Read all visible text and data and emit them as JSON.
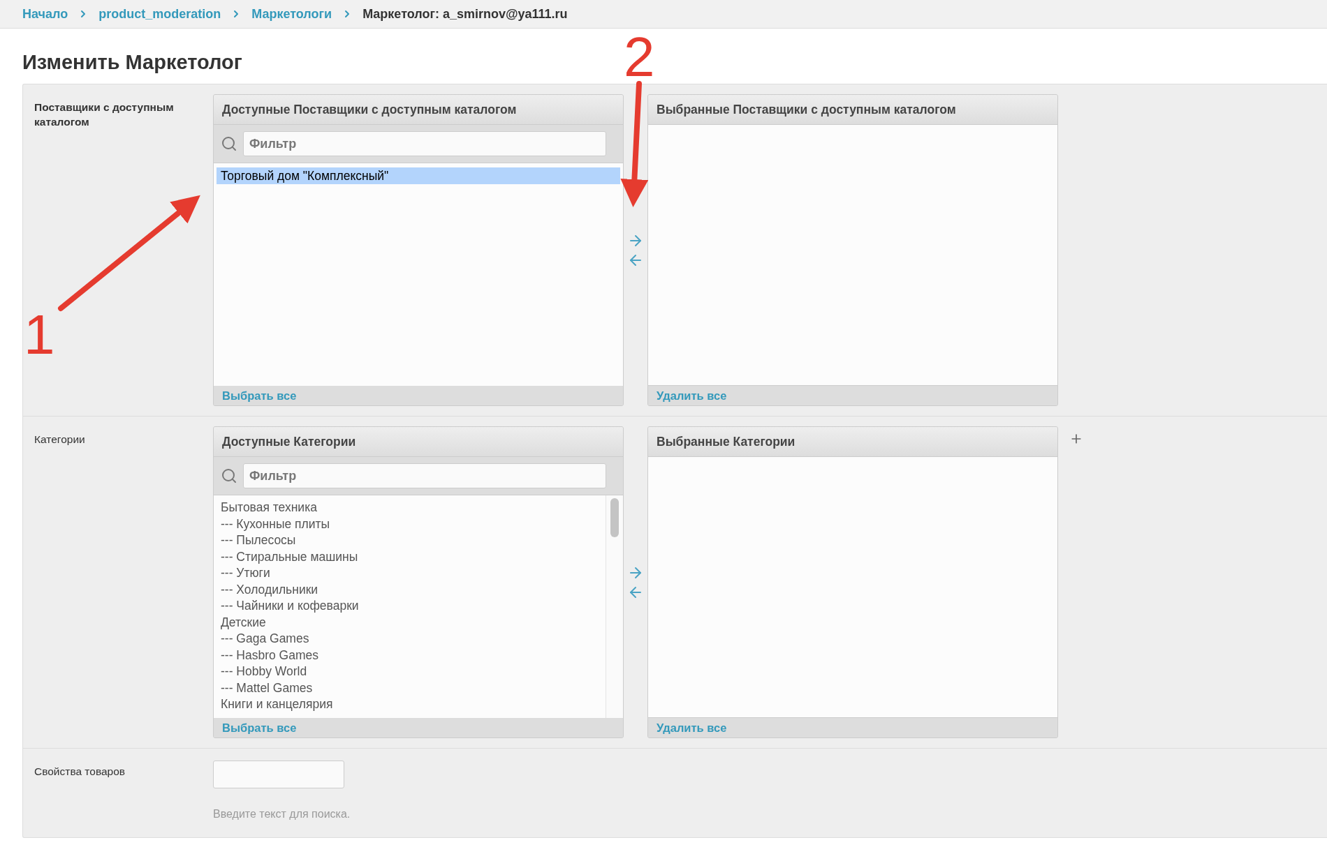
{
  "breadcrumbs": [
    {
      "label": "Начало",
      "link": true
    },
    {
      "label": "product_moderation",
      "link": true
    },
    {
      "label": "Маркетологи",
      "link": true
    },
    {
      "label": "Маркетолог: a_smirnov@ya111.ru",
      "link": false
    }
  ],
  "title": "Изменить Маркетолог",
  "fields": [
    {
      "kind": "selector",
      "label": "Поставщики с доступным каталогом",
      "available": {
        "title": "Доступные Поставщики с доступным каталогом",
        "filter_placeholder": "Фильтр",
        "items": [
          {
            "label": "Торговый дом \"Комплексный\"",
            "selected": true
          }
        ],
        "action": "Выбрать все"
      },
      "chosen": {
        "title": "Выбранные Поставщики с доступным каталогом",
        "action": "Удалить все"
      }
    },
    {
      "kind": "selector",
      "label": "Категории",
      "add_button": true,
      "available": {
        "title": "Доступные Категории",
        "filter_placeholder": "Фильтр",
        "scrollbar": true,
        "items": [
          {
            "label": "Бытовая техника",
            "selected": false
          },
          {
            "label": "--- Кухонные плиты",
            "selected": false
          },
          {
            "label": "--- Пылесосы",
            "selected": false
          },
          {
            "label": "--- Стиральные машины",
            "selected": false
          },
          {
            "label": "--- Утюги",
            "selected": false
          },
          {
            "label": "--- Холодильники",
            "selected": false
          },
          {
            "label": "--- Чайники и кофеварки",
            "selected": false
          },
          {
            "label": "Детские",
            "selected": false
          },
          {
            "label": "--- Gaga Games",
            "selected": false
          },
          {
            "label": "--- Hasbro Games",
            "selected": false
          },
          {
            "label": "--- Hobby World",
            "selected": false
          },
          {
            "label": "--- Mattel Games",
            "selected": false
          },
          {
            "label": "Книги и канцелярия",
            "selected": false
          }
        ],
        "action": "Выбрать все"
      },
      "chosen": {
        "title": "Выбранные Категории",
        "action": "Удалить все"
      }
    },
    {
      "kind": "text",
      "label": "Свойства товаров",
      "help": "Введите текст для поиска."
    }
  ],
  "annotations": [
    {
      "label": "1"
    },
    {
      "label": "2"
    }
  ]
}
